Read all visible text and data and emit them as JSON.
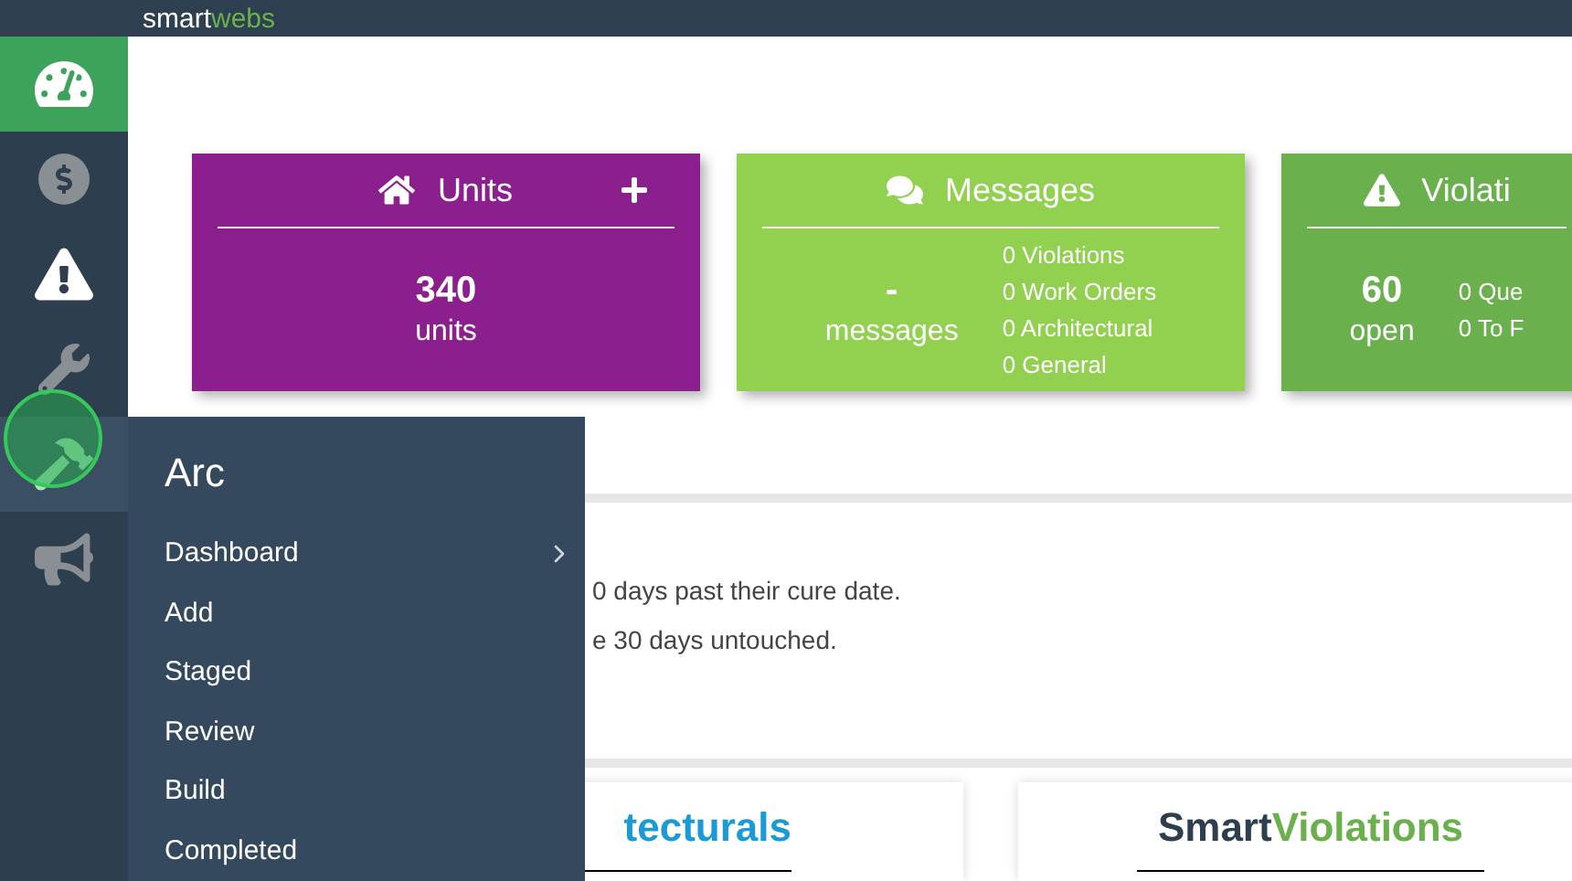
{
  "header": {
    "logo_prefix": "smart",
    "logo_suffix": "webs"
  },
  "sidebar": {
    "items": [
      {
        "kind": "dashboard",
        "selected": true,
        "expanded": false
      },
      {
        "kind": "money",
        "selected": false,
        "expanded": false
      },
      {
        "kind": "warning",
        "selected": false,
        "expanded": false
      },
      {
        "kind": "wrench",
        "selected": false,
        "expanded": false
      },
      {
        "kind": "hammer",
        "selected": false,
        "expanded": true
      },
      {
        "kind": "megaphone",
        "selected": false,
        "expanded": false
      }
    ]
  },
  "flyout": {
    "title": "Arc",
    "items": [
      {
        "label": "Dashboard",
        "has_submenu": true
      },
      {
        "label": "Add",
        "has_submenu": false
      },
      {
        "label": "Staged",
        "has_submenu": false
      },
      {
        "label": "Review",
        "has_submenu": false
      },
      {
        "label": "Build",
        "has_submenu": false
      },
      {
        "label": "Completed",
        "has_submenu": false
      }
    ]
  },
  "cards": [
    {
      "kind": "units",
      "title": "Units",
      "color": "#8b1f8e",
      "value": "340",
      "unit": "units",
      "addable": true
    },
    {
      "kind": "messages",
      "title": "Messages",
      "color": "#92d050",
      "value": "-",
      "unit": "messages",
      "addable": false,
      "lines": [
        "0 Violations",
        "0 Work Orders",
        "0 Architectural",
        "0 General"
      ]
    },
    {
      "kind": "violations",
      "title": "Violati",
      "color": "#6ab04c",
      "value": "60",
      "unit": "open",
      "addable": false,
      "lines": [
        "0 Que",
        "0 To F"
      ]
    }
  ],
  "notices": [
    "0 days past their cure date.",
    "e 30 days untouched."
  ],
  "bottom_cards": [
    {
      "name": "tecturals",
      "color": "#1a9ad6"
    },
    {
      "prefix": "Smart",
      "name": "Violations",
      "color": "#6ab04c"
    }
  ]
}
